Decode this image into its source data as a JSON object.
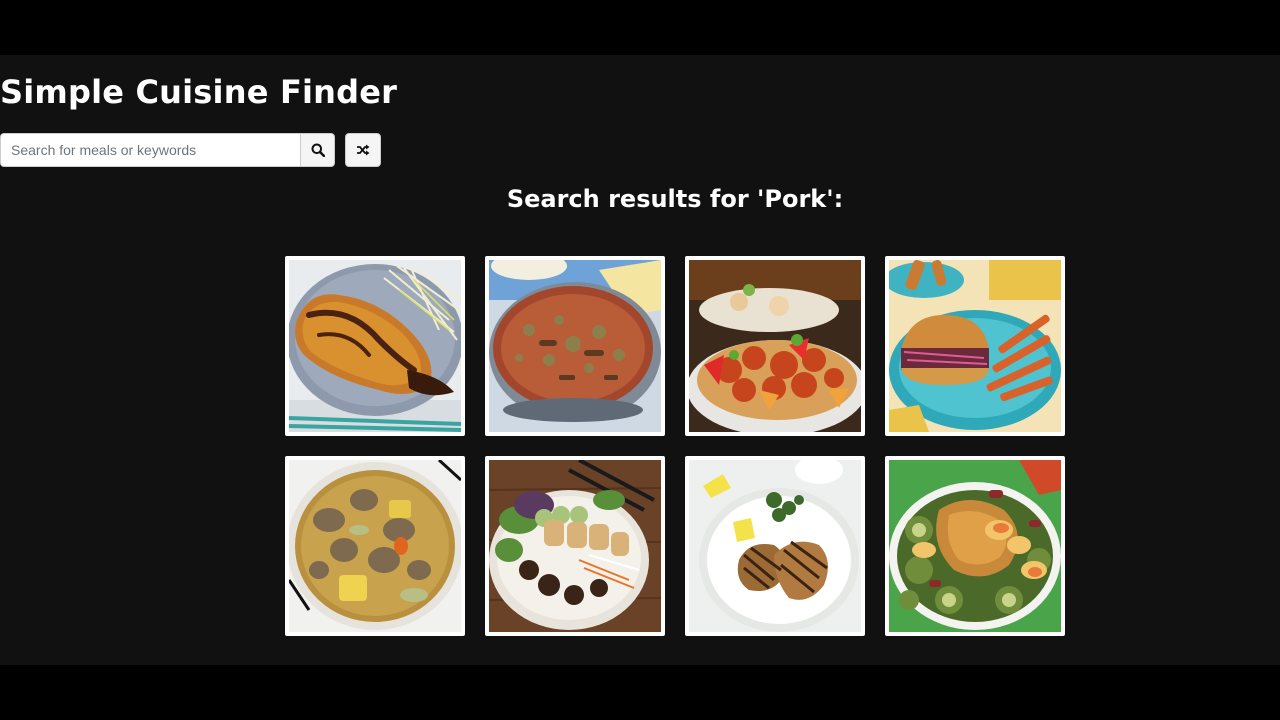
{
  "app": {
    "title": "Simple Cuisine Finder"
  },
  "search": {
    "value": "",
    "placeholder": "Search for meals or keywords",
    "button_icon": "search-icon",
    "random_icon": "shuffle-icon"
  },
  "results": {
    "heading": "Search results for 'Pork':",
    "meals": [
      {
        "image": "tonkatsu-cutlet-plate"
      },
      {
        "image": "pork-casserole-pan"
      },
      {
        "image": "sweet-and-sour-pork"
      },
      {
        "image": "pulled-pork-sandwich-fries"
      },
      {
        "image": "pork-stew-bowl"
      },
      {
        "image": "pork-noodle-bowl-spring-rolls"
      },
      {
        "image": "grilled-pork-steaks"
      },
      {
        "image": "pork-chop-zucchini-peaches"
      }
    ]
  },
  "colors": {
    "background": "#111111",
    "letterbox": "#000000",
    "text": "#ffffff",
    "card_border": "#ffffff"
  }
}
